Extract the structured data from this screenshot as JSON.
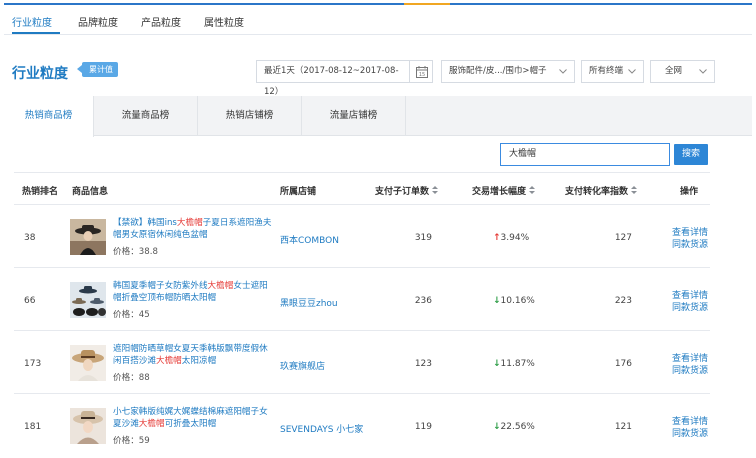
{
  "top_tabs": [
    "行业粒度",
    "品牌粒度",
    "产品粒度",
    "属性粒度"
  ],
  "section": {
    "title": "行业粒度",
    "badge": "累计值"
  },
  "filters": {
    "date_range": "最近1天（2017-08-12~2017-08-12）",
    "category": "服饰配件/皮.../围巾>帽子",
    "terminal": "所有终端",
    "network": "全网"
  },
  "tabs": [
    "热销商品榜",
    "流量商品榜",
    "热销店铺榜",
    "流量店铺榜"
  ],
  "search": {
    "value": "大檐帽",
    "button": "搜索"
  },
  "columns": {
    "rank": "热销排名",
    "product": "商品信息",
    "store": "所属店铺",
    "orders": "支付子订单数",
    "growth": "交易增长幅度",
    "conversion": "支付转化率指数",
    "action": "操作"
  },
  "rows": [
    {
      "rank": "38",
      "title_pre": "【禁欲】韩国ins",
      "title_kw": "大檐帽",
      "title_post": "子夏日系遮阳渔夫帽男女原宿休闲纯色盆帽",
      "price": "价格：38.8",
      "store": "西本COMBON",
      "orders": "319",
      "growth": "3.94%",
      "growth_dir": "up",
      "conversion": "127",
      "action1": "查看详情",
      "action2": "同款货源"
    },
    {
      "rank": "66",
      "title_pre": "韩国夏季帽子女防紫外线",
      "title_kw": "大檐帽",
      "title_post": "女士遮阳帽折叠空顶布帽防晒太阳帽",
      "price": "价格：45",
      "store": "黑眼豆豆zhou",
      "orders": "236",
      "growth": "10.16%",
      "growth_dir": "down",
      "conversion": "223",
      "action1": "查看详情",
      "action2": "同款货源"
    },
    {
      "rank": "173",
      "title_pre": "遮阳帽防晒草帽女夏天季韩版飘带度假休闲百搭沙滩",
      "title_kw": "大檐帽",
      "title_post": "太阳凉帽",
      "price": "价格：88",
      "store": "玖赛旗舰店",
      "orders": "123",
      "growth": "11.87%",
      "growth_dir": "down",
      "conversion": "176",
      "action1": "查看详情",
      "action2": "同款货源"
    },
    {
      "rank": "181",
      "title_pre": "小七家韩版纯娓大娓蝶结棉麻遮阳帽子女夏沙滩",
      "title_kw": "大檐帽",
      "title_post": "可折叠太阳帽",
      "price": "价格：59",
      "store": "SEVENDAYS 小七家",
      "orders": "119",
      "growth": "22.56%",
      "growth_dir": "down",
      "conversion": "121",
      "action1": "查看详情",
      "action2": "同款货源"
    }
  ]
}
